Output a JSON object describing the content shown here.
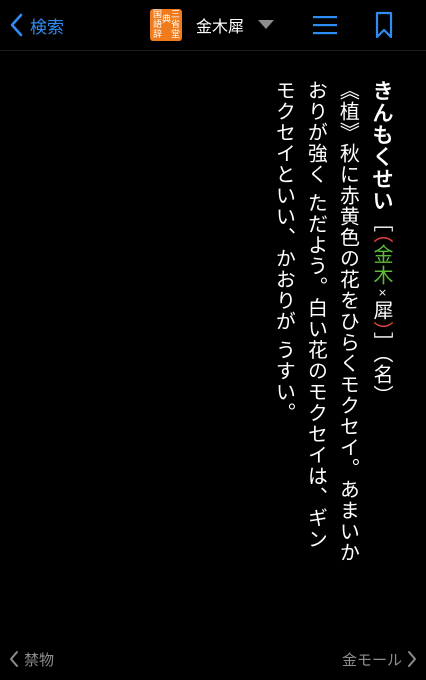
{
  "nav": {
    "back_label": "検索",
    "title": "金木犀",
    "logo_glyphs": [
      "国",
      "語",
      "辞",
      "典",
      "三",
      "省",
      "堂"
    ]
  },
  "entry": {
    "headword": "きんもくせい",
    "bracket_open": "［",
    "paren_open": "（",
    "kanji_1": "金",
    "kanji_2": "木",
    "kanji_mark": "×",
    "kanji_3": "犀",
    "paren_close": "）",
    "bracket_close": "］",
    "pos": "（名）",
    "lines": [
      "《植》秋に赤黄色の花をひらくモクセイ。あまいか",
      "おりが強く ただよう。白い花のモクセイは、ギン",
      "モクセイといい、かおりが うすい。"
    ]
  },
  "footer": {
    "prev_label": "禁物",
    "next_label": "金モール"
  },
  "colors": {
    "accent": "#2f8cf2",
    "logo_bg": "#ef7b1c",
    "kanji_green": "#5dbb39",
    "paren_red": "#e2453b",
    "footer_text": "#8d8d8d"
  },
  "icons": {
    "back": "chevron-left-icon",
    "menu": "hamburger-menu-icon",
    "bookmark": "bookmark-icon",
    "caret": "caret-down-icon"
  }
}
